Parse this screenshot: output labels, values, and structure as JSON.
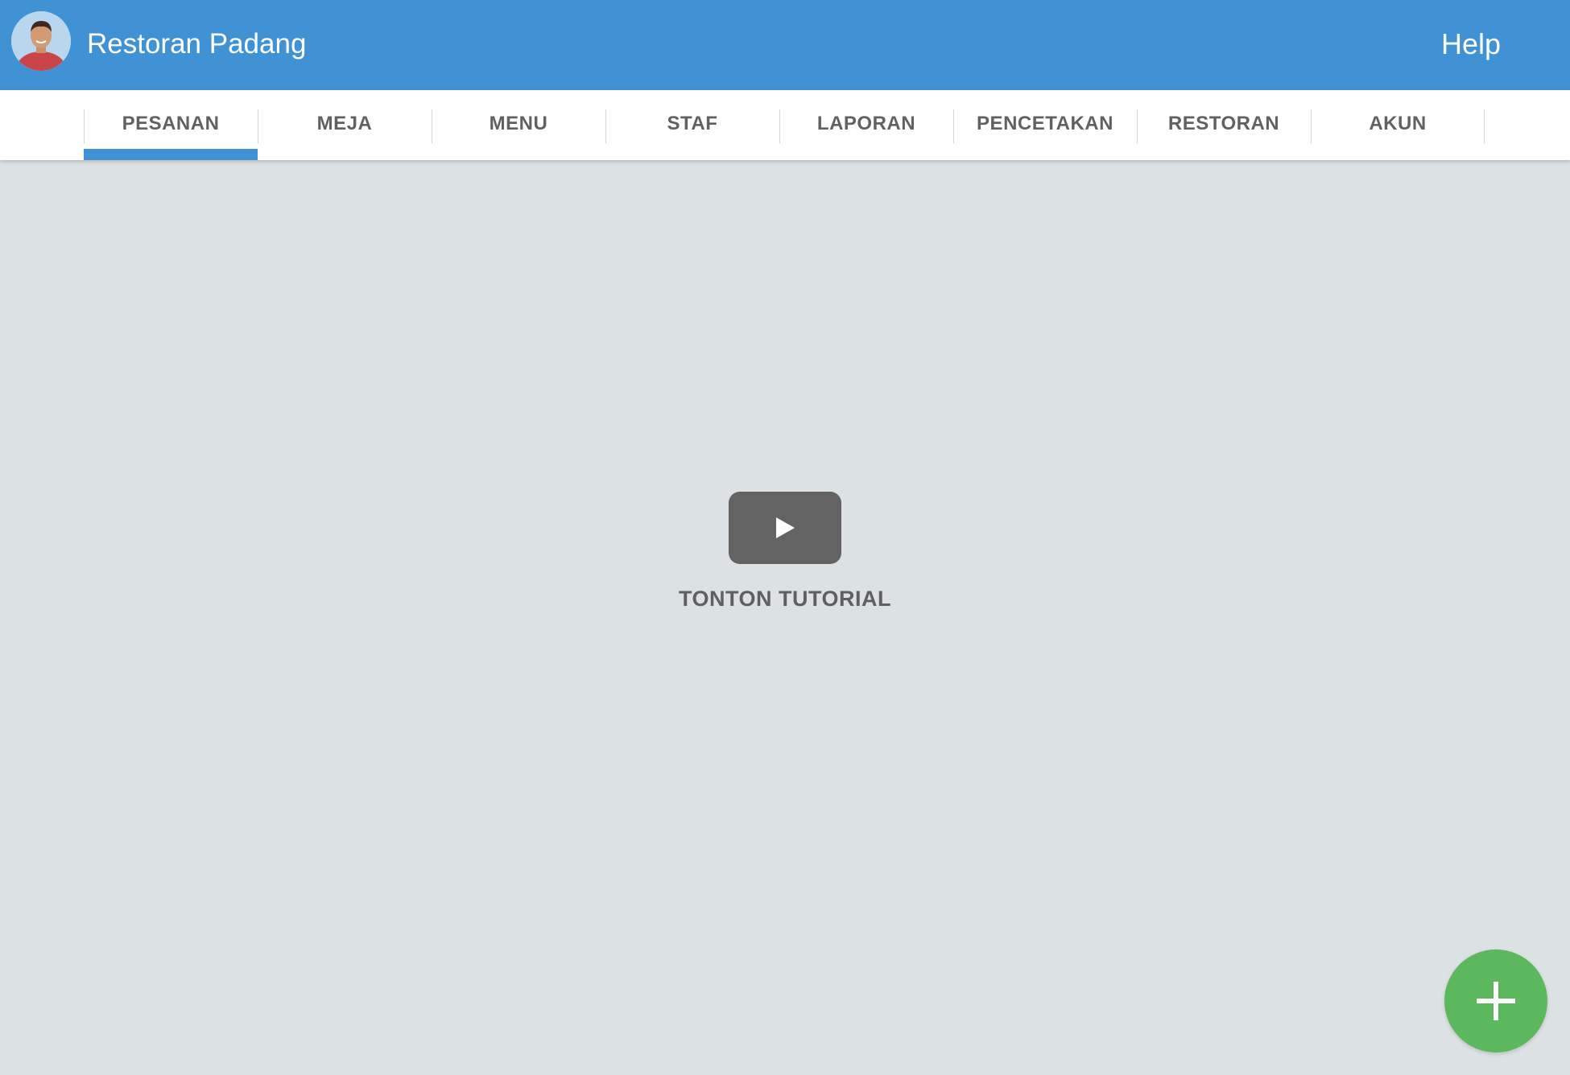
{
  "header": {
    "app_title": "Restoran Padang",
    "help_label": "Help",
    "avatar_icon": "user-avatar"
  },
  "tabs": [
    {
      "label": "PESANAN",
      "active": true
    },
    {
      "label": "MEJA",
      "active": false
    },
    {
      "label": "MENU",
      "active": false
    },
    {
      "label": "STAF",
      "active": false
    },
    {
      "label": "LAPORAN",
      "active": false
    },
    {
      "label": "PENCETAKAN",
      "active": false
    },
    {
      "label": "RESTORAN",
      "active": false
    },
    {
      "label": "AKUN",
      "active": false
    }
  ],
  "main": {
    "tutorial_label": "TONTON TUTORIAL",
    "play_icon": "play-icon"
  },
  "fab": {
    "icon": "plus-icon"
  },
  "colors": {
    "primary": "#4092d4",
    "background": "#dce1e4",
    "fab": "#5cb85c",
    "tab_text": "#616161",
    "play_button": "#636363"
  }
}
